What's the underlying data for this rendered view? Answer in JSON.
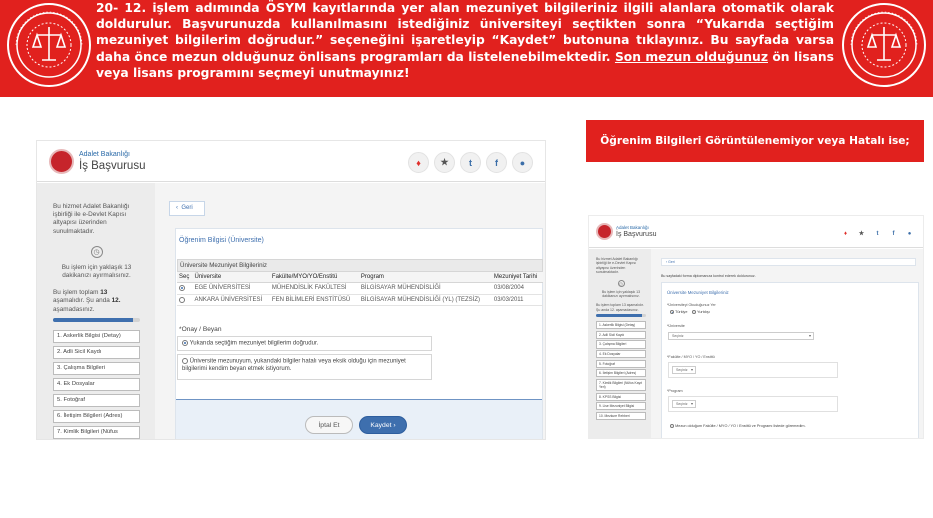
{
  "banner": {
    "text_before_link": "20- 12. işlem adımında ÖSYM kayıtlarında yer alan mezuniyet bilgileriniz ilgili alanlara otomatik olarak doldurulur. Başvurunuzda kullanılmasını istediğiniz üniversiteyi seçtikten sonra “Yukarıda seçtiğim mezuniyet bilgilerim doğrudur.” seçeneğini işaretleyip “Kaydet” butonuna tıklayınız. Bu sayfada varsa daha önce mezun olduğunuz önlisans programları da listelenebilmektedir. ",
    "underlined": "Son mezun olduğunuz",
    "text_after_link": " ön lisans veya lisans programını seçmeyi unutmayınız!",
    "color": "#e1211e"
  },
  "app": {
    "org": "Adalet Bakanlığı",
    "title": "İş Başvurusu",
    "social_icons": [
      "fire-icon",
      "star-icon",
      "twitter-icon",
      "facebook-icon",
      "chat-icon"
    ]
  },
  "screen_a": {
    "sidebar": {
      "intro": "Bu hizmet Adalet Bakanlığı işbirliği ile e-Devlet Kapısı altyapısı üzerinden sunulmaktadır.",
      "timeout": "Bu işlem için yaklaşık 13 dakikanızı ayırmalısınız.",
      "steps_prefix": "Bu işlem toplam ",
      "steps_total": "13",
      "steps_mid": " aşamalıdır. Şu anda ",
      "steps_current": "12.",
      "steps_suffix": " aşamadasınız.",
      "progress": 0.92,
      "steps": [
        "1. Askerlik Bilgisi (Detay)",
        "2. Adli Sicil Kaydı",
        "3. Çalışma Bilgileri",
        "4. Ek Dosyalar",
        "5. Fotoğraf",
        "6. İletişim Bilgileri (Adres)",
        "7. Kimlik Bilgileri (Nüfus"
      ]
    },
    "back_label": "Geri",
    "section_title": "Öğrenim Bilgisi (Üniversite)",
    "table_caption": "Üniversite Mezuniyet Bilgileriniz",
    "columns": [
      "Seç",
      "Üniversite",
      "Fakülte/MYO/YO/Enstitü",
      "Program",
      "Mezuniyet Tarihi"
    ],
    "rows": [
      {
        "selected": true,
        "university": "EGE ÜNİVERSİTESİ",
        "faculty": "MÜHENDİSLİK FAKÜLTESİ",
        "program": "BİLGİSAYAR MÜHENDİSLİĞİ",
        "date": "03/08/2004"
      },
      {
        "selected": false,
        "university": "ANKARA ÜNİVERSİTESİ",
        "faculty": "FEN BİLİMLERİ ENSTİTÜSÜ",
        "program": "BİLGİSAYAR MÜHENDİSLİĞİ (YL) (TEZSİZ)",
        "date": "03/03/2011"
      }
    ],
    "confirm_title": "*Onay / Beyan",
    "option_yes": "Yukarıda seçtiğim mezuniyet bilgilerim doğrudur.",
    "option_no": "Üniversite mezunuyum, yukarıdaki bilgiler hatalı veya eksik olduğu için mezuniyet bilgilerimi kendim beyan etmek istiyorum.",
    "cancel_label": "İptal Et",
    "save_label": "Kaydet"
  },
  "red_label": "Öğrenim Bilgileri Görüntülenemiyor veya Hatalı ise;",
  "screen_b": {
    "sidebar": {
      "intro": "Bu hizmet Adalet Bakanlığı işbirliği ile e-Devlet Kapısı altyapısı üzerinden sunulmaktadır.",
      "timeout": "Bu işlem için yaklaşık 13 dakikanızı ayırmalısınız.",
      "steps_text": "Bu işlem toplam 13 aşamalıdır. Şu anda 12. aşamadasınız.",
      "steps": [
        "1. Askerlik Bilgisi (Detay)",
        "2. Adli Sicil Kaydı",
        "3. Çalışma Bilgileri",
        "4. Ek Dosyalar",
        "5. Fotoğraf",
        "6. İletişim Bilgileri (Adres)",
        "7. Kimlik Bilgileri (Nüfus Kayıt Yeri)",
        "8. KPSS Bilgisi",
        "9. Lise Mezuniyet Bilgisi",
        "10. Mezkure Rehberi"
      ]
    },
    "back_label": "Geri",
    "note": "Bu sayfadaki forma diplomanıza kontrol ederek doldurunuz.",
    "section_title": "Üniversite Mezuniyet Bilgileriniz",
    "q_university_abroad": "*Üniversiteyi Okuduğunuz Yer",
    "opt_turkey": "Türkiye",
    "opt_abroad": "Yurtdışı",
    "university_label": "*Üniversite",
    "faculty_label": "*Fakülte / MYO / YO / Enstitü",
    "program_label": "*Program",
    "select_placeholder": "Seçiniz",
    "missing_option": "Mezun olduğum Fakülte / MYO / YO / Enstitü ve Programı listede göremedim."
  }
}
